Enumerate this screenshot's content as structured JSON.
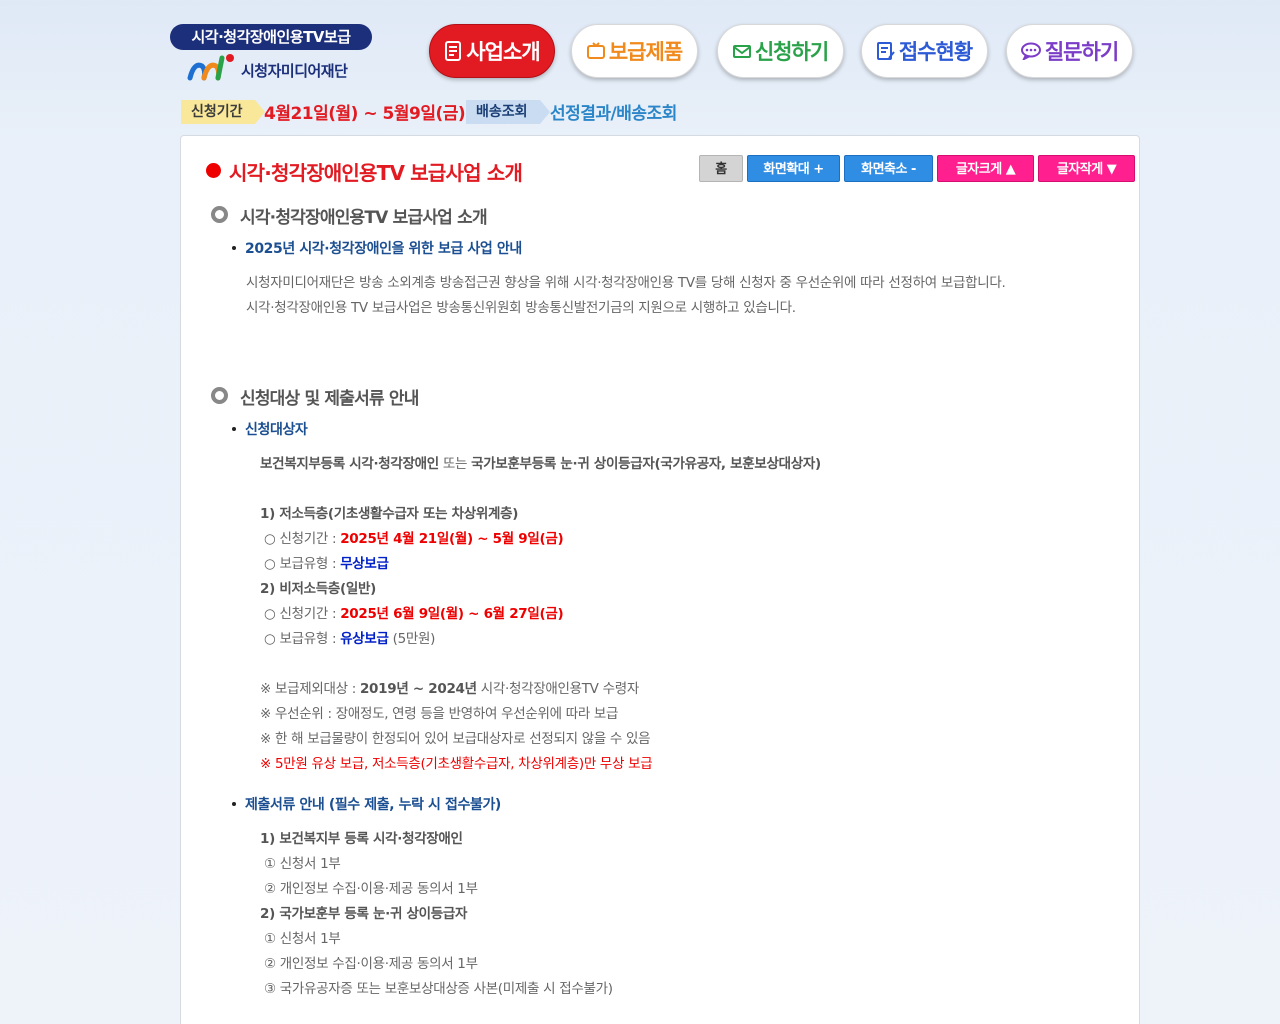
{
  "header": {
    "logo_pill": "시각·청각장애인용TV보급",
    "logo_org": "시청자미디어재단"
  },
  "nav": [
    {
      "label": "사업소개",
      "icon": "document-icon",
      "active": true
    },
    {
      "label": "보급제품",
      "icon": "tv-icon",
      "active": false
    },
    {
      "label": "신청하기",
      "icon": "envelope-icon",
      "active": false
    },
    {
      "label": "접수현황",
      "icon": "checklist-icon",
      "active": false
    },
    {
      "label": "질문하기",
      "icon": "chat-bubble-icon",
      "active": false
    }
  ],
  "period": {
    "tag": "신청기간",
    "dates": "4월21일(월) ~ 5월9일(금)",
    "delivery_tag": "배송조회",
    "delivery_link": "선정결과/배송조회"
  },
  "colors": {
    "accent_red": "#e21b23",
    "brand_navy": "#1c2f7a",
    "link_blue": "#2a86c8",
    "tool_pink": "#ff1f8e",
    "tool_blue": "#2f8de4"
  },
  "main": {
    "page_title": "시각·청각장애인용TV 보급사업 소개",
    "toolbar": {
      "home": "홈",
      "zoom_in": "화면확대 +",
      "zoom_out": "화면축소 -",
      "font_up": "글자크게",
      "font_down": "글자작게"
    },
    "section1": {
      "title": "시각·청각장애인용TV 보급사업 소개",
      "subtitle": "2025년 시각·청각장애인을 위한 보급 사업 안내",
      "line1": "시청자미디어재단은 방송 소외계층 방송접근권 향상을 위해 시각·청각장애인용 TV를 당해 신청자 중 우선순위에 따라 선정하여 보급합니다.",
      "line2": "시각·청각장애인용 TV 보급사업은 방송통신위원회 방송통신발전기금의 지원으로 시행하고 있습니다."
    },
    "section2": {
      "title": "신청대상 및 제출서류 안내",
      "target_title": "신청대상자",
      "target_a": "보건복지부등록 시각·청각장애인",
      "target_or": " 또는 ",
      "target_b": "국가보훈부등록 눈·귀 상이등급자(국가유공자, 보훈보상대상자)",
      "group1_title": "1) 저소득층(기초생활수급자 또는 차상위계층)",
      "group1_period_label": "○ 신청기간 : ",
      "group1_period": "2025년 4월 21일(월) ~ 5월 9일(금)",
      "group1_type_label": "○ 보급유형 : ",
      "group1_type": "무상보급",
      "group2_title": "2) 비저소득층(일반)",
      "group2_period_label": "○ 신청기간 : ",
      "group2_period": "2025년 6월 9일(월) ~ 6월 27일(금)",
      "group2_type_label": "○ 보급유형 : ",
      "group2_type": "유상보급",
      "group2_price": " (5만원)",
      "note1_label": "※ 보급제외대상 : ",
      "note1_years": "2019년 ~ 2024년",
      "note1_rest": " 시각·청각장애인용TV 수령자",
      "note2": "※ 우선순위 : 장애정도, 연령 등을 반영하여 우선순위에 따라 보급",
      "note3": "※ 한 해 보급물량이 한정되어 있어 보급대상자로 선정되지 않을 수 있음",
      "note4": "※ 5만원 유상 보급, 저소득층(기초생활수급자, 차상위계층)만 무상 보급",
      "docs_title": "제출서류 안내 (필수 제출, 누락 시 접수불가)",
      "docs_group1": "1) 보건복지부 등록 시각·청각장애인",
      "docs_g1_item1": "① 신청서 1부",
      "docs_g1_item2": "② 개인정보 수집·이용·제공 동의서 1부",
      "docs_group2": "2) 국가보훈부 등록 눈·귀 상이등급자",
      "docs_g2_item1": "① 신청서 1부",
      "docs_g2_item2": "② 개인정보 수집·이용·제공 동의서 1부",
      "docs_g2_item3": "③ 국가유공자증 또는 보훈보상대상증 사본(미제출 시 접수불가)"
    }
  }
}
